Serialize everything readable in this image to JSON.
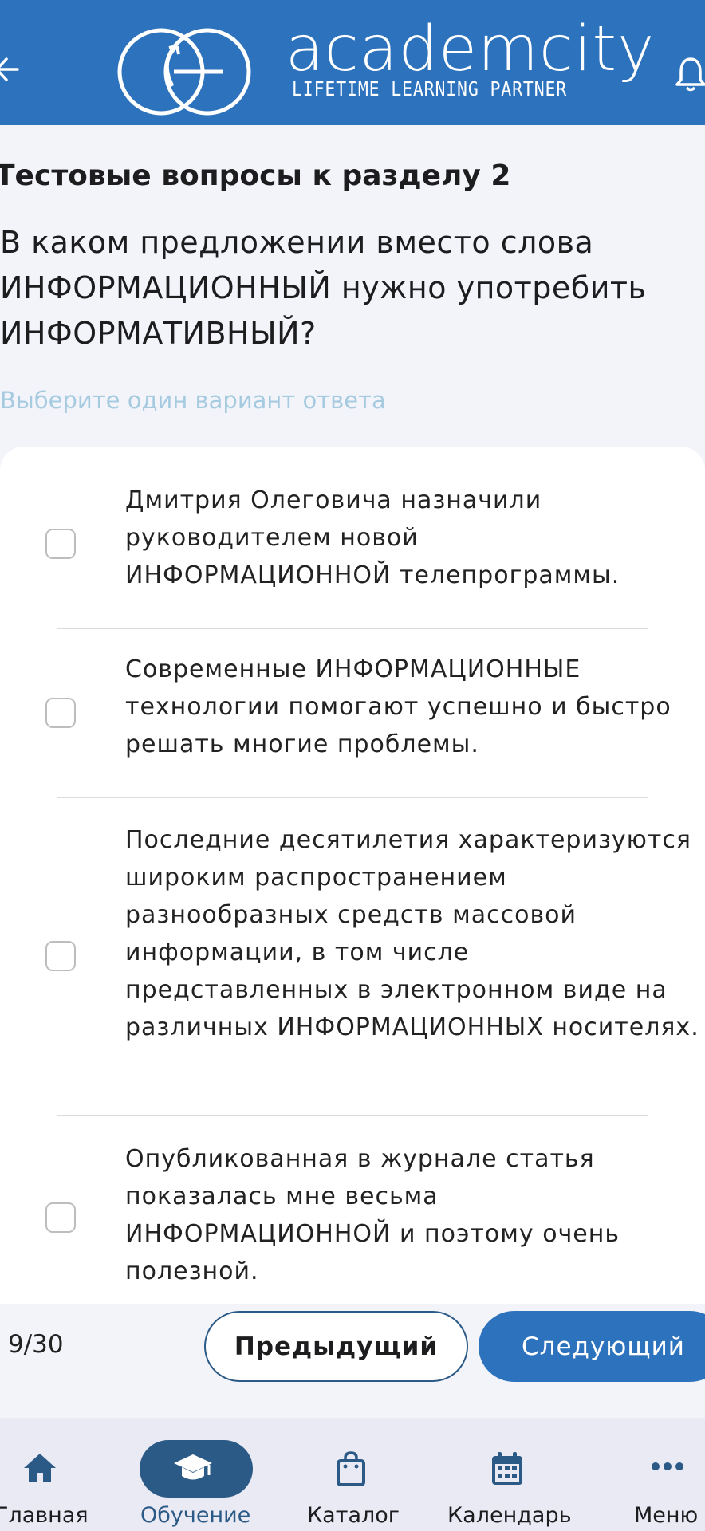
{
  "header": {
    "logo_word": "academcity",
    "logo_tagline": "LIFETIME LEARNING PARTNER",
    "brand_color": "#2d72bc"
  },
  "test": {
    "section_title": "Тестовые вопросы к разделу 2",
    "question": "В каком предложении вместо слова ИНФОРМАЦИОННЫЙ нужно употребить ИНФОРМАТИВНЫЙ?",
    "hint": "Выберите один вариант ответа",
    "options": [
      {
        "text": "Дмитрия Олеговича назначили руководителем новой ИНФОРМАЦИОННОЙ телепрограммы.",
        "checked": false
      },
      {
        "text": "Современные ИНФОРМАЦИОННЫЕ технологии помогают успешно и быстро решать многие проблемы.",
        "checked": false
      },
      {
        "text": "Последние десятилетия характеризуются широким распространением разнообразных средств массовой информации, в том числе представленных в электронном виде на различных ИНФОРМАЦИОННЫХ носителях.",
        "checked": false
      },
      {
        "text": "Опубликованная в журнале статья показалась мне весьма ИНФОРМАЦИОННОЙ и поэтому очень полезной.",
        "checked": false
      }
    ]
  },
  "navigation": {
    "progress": "9/30",
    "prev_label": "Предыдущий",
    "next_label": "Следующий"
  },
  "tabbar": {
    "items": [
      {
        "label": "Главная",
        "icon": "home-icon",
        "active": false
      },
      {
        "label": "Обучение",
        "icon": "graduation-cap-icon",
        "active": true
      },
      {
        "label": "Каталог",
        "icon": "shopping-bag-icon",
        "active": false
      },
      {
        "label": "Календарь",
        "icon": "calendar-icon",
        "active": false
      },
      {
        "label": "Меню",
        "icon": "more-dots-icon",
        "active": false
      }
    ],
    "active_color": "#2c5a86"
  }
}
